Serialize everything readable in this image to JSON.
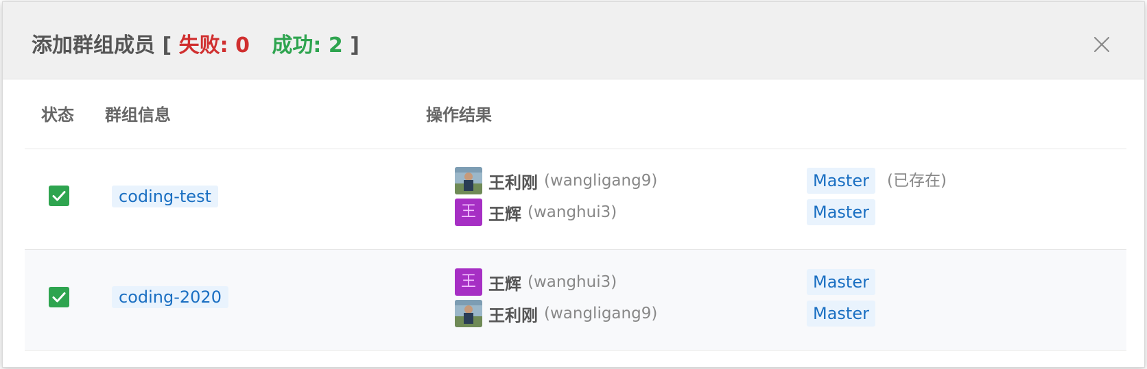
{
  "modal": {
    "title": "添加群组成员",
    "bracket_open": "[",
    "bracket_close": "]",
    "fail_label": "失败: 0",
    "success_label": "成功: 2"
  },
  "columns": {
    "status": "状态",
    "group": "群组信息",
    "result": "操作结果"
  },
  "rows": [
    {
      "status": "success",
      "group": "coding-test",
      "members": [
        {
          "name": "王利刚",
          "username": "(wangligang9)",
          "avatar": "photo",
          "role": "Master",
          "note": "(已存在)"
        },
        {
          "name": "王辉",
          "username": "(wanghui3)",
          "avatar_letter": "王",
          "role": "Master",
          "note": ""
        }
      ]
    },
    {
      "status": "success",
      "group": "coding-2020",
      "members": [
        {
          "name": "王辉",
          "username": "(wanghui3)",
          "avatar_letter": "王",
          "role": "Master",
          "note": ""
        },
        {
          "name": "王利刚",
          "username": "(wangligang9)",
          "avatar": "photo",
          "role": "Master",
          "note": ""
        }
      ]
    }
  ],
  "icons": {
    "close": "close-icon",
    "check": "checkbox-checked-icon"
  },
  "colors": {
    "fail": "#d02f2f",
    "success": "#2ea44f",
    "link": "#1a6fc2",
    "tag_bg": "#e9f3fd",
    "letter_avatar": "#a62fc4"
  }
}
